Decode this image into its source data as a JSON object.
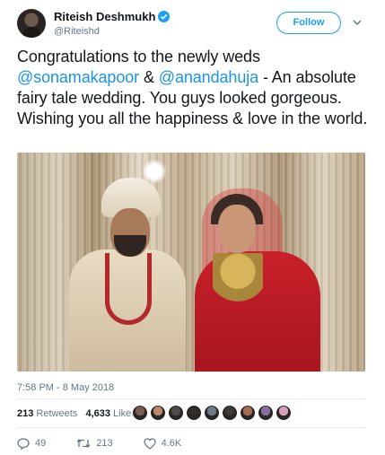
{
  "author": {
    "name": "Riteish Deshmukh",
    "handle": "@Riteishd",
    "verified_icon": "verified-badge-icon"
  },
  "follow_label": "Follow",
  "tweet": {
    "text_intro": "Congratulations to the newly weds",
    "mention_1": "@sonamakapoor",
    "joiner": " & ",
    "mention_2": "@anandahuja",
    "text_rest": " - An absolute fairy tale wedding. You guys looked gorgeous. Wishing you all the happiness & love in the world."
  },
  "photo": {
    "alt_icon": "wedding-photo"
  },
  "timestamp": "7:58 PM - 8 May 2018",
  "stats": {
    "retweets_count": "213",
    "retweets_label": "Retweets",
    "likes_count": "4,633",
    "likes_label": "Likes"
  },
  "liker_colors": [
    "#7a5d4f",
    "#b9896c",
    "#4b4b4b",
    "#2f2f2f",
    "#6d7a88",
    "#3e3a38",
    "#a36b52",
    "#8c6fa0",
    "#d8a0b8"
  ],
  "actions": {
    "replies": "49",
    "retweets": "213",
    "likes": "4.6K"
  },
  "colors": {
    "accent": "#1da1f2",
    "mention": "#1b95e0",
    "muted": "#657786",
    "text": "#14171a"
  }
}
